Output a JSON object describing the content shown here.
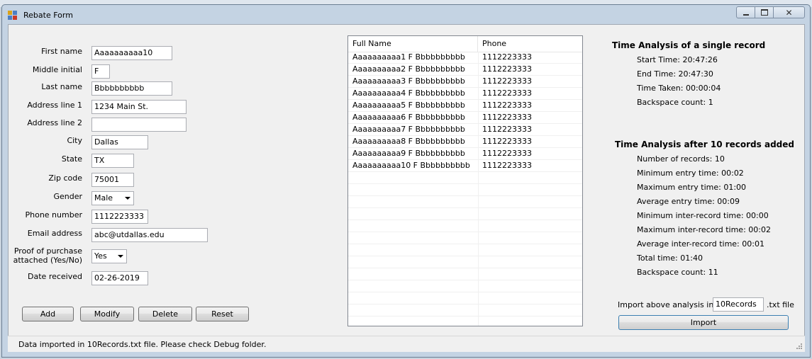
{
  "window": {
    "title": "Rebate Form"
  },
  "form": {
    "first_name": {
      "label": "First name",
      "value": "Aaaaaaaaaa10"
    },
    "middle_initial": {
      "label": "Middle initial",
      "value": "F"
    },
    "last_name": {
      "label": "Last name",
      "value": "Bbbbbbbbbb"
    },
    "address1": {
      "label": "Address line 1",
      "value": "1234 Main St."
    },
    "address2": {
      "label": "Address line 2",
      "value": ""
    },
    "city": {
      "label": "City",
      "value": "Dallas"
    },
    "state": {
      "label": "State",
      "value": "TX"
    },
    "zip": {
      "label": "Zip code",
      "value": "75001"
    },
    "gender": {
      "label": "Gender",
      "value": "Male"
    },
    "phone": {
      "label": "Phone number",
      "value": "1112223333"
    },
    "email": {
      "label": "Email address",
      "value": "abc@utdallas.edu"
    },
    "proof": {
      "label_line1": "Proof of purchase",
      "label_line2": "attached (Yes/No)",
      "value": "Yes"
    },
    "date": {
      "label": "Date received",
      "value": "02-26-2019"
    }
  },
  "buttons": {
    "add": "Add",
    "modify": "Modify",
    "delete": "Delete",
    "reset": "Reset"
  },
  "records": {
    "columns": [
      "Full Name",
      "Phone"
    ],
    "rows": [
      [
        "Aaaaaaaaaa1 F Bbbbbbbbbb",
        "1112223333"
      ],
      [
        "Aaaaaaaaaa2 F Bbbbbbbbbb",
        "1112223333"
      ],
      [
        "Aaaaaaaaaa3 F Bbbbbbbbbb",
        "1112223333"
      ],
      [
        "Aaaaaaaaaa4 F Bbbbbbbbbb",
        "1112223333"
      ],
      [
        "Aaaaaaaaaa5 F Bbbbbbbbbb",
        "1112223333"
      ],
      [
        "Aaaaaaaaaa6 F Bbbbbbbbbb",
        "1112223333"
      ],
      [
        "Aaaaaaaaaa7 F Bbbbbbbbbb",
        "1112223333"
      ],
      [
        "Aaaaaaaaaa8 F Bbbbbbbbbb",
        "1112223333"
      ],
      [
        "Aaaaaaaaaa9 F Bbbbbbbbbb",
        "1112223333"
      ],
      [
        "Aaaaaaaaaa10 F Bbbbbbbbbb",
        "1112223333"
      ]
    ]
  },
  "single": {
    "heading": "Time Analysis of a single record",
    "start": "Start Time: 20:47:26",
    "end": "End Time: 20:47:30",
    "taken": "Time Taken: 00:00:04",
    "backspace": "Backspace count: 1"
  },
  "batch": {
    "heading": "Time Analysis after 10 records added",
    "count": "Number of records: 10",
    "min_entry": "Minimum entry time: 00:02",
    "max_entry": "Maximum entry time: 01:00",
    "avg_entry": "Average entry time: 00:09",
    "min_inter": "Minimum inter-record time: 00:00",
    "max_inter": "Maximum inter-record time: 00:02",
    "avg_inter": "Average inter-record time: 00:01",
    "total": "Total time: 01:40",
    "backspace": "Backspace count: 11"
  },
  "import": {
    "prefix": "Import above analysis into a",
    "filename": "10Records",
    "suffix": ".txt file",
    "button": "Import"
  },
  "status": {
    "text": "Data imported in 10Records.txt file. Please check Debug folder."
  },
  "icons": {
    "app": "form-app-icon",
    "minimize": "minimize-icon",
    "maximize": "maximize-icon",
    "close": "close-icon",
    "grip": "resize-grip-icon"
  }
}
